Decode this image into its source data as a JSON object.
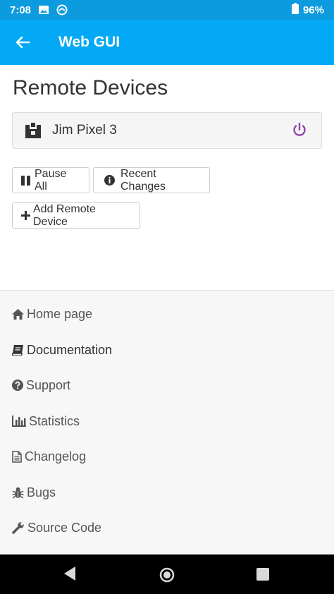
{
  "status_bar": {
    "time": "7:08",
    "battery": "96%",
    "icons": [
      "image-icon",
      "sync-icon",
      "battery-icon"
    ]
  },
  "app_bar": {
    "title": "Web GUI",
    "back_icon": "arrow-left-icon",
    "color": "#03a9f4"
  },
  "page": {
    "title": "Remote Devices",
    "devices": [
      {
        "name": "Jim Pixel 3",
        "icon": "device-identicon",
        "action_icon": "power-icon",
        "action_color": "#8e44ad"
      }
    ],
    "buttons": {
      "pause_all": "Pause All",
      "recent_changes": "Recent Changes",
      "add_remote_device": "Add Remote Device"
    }
  },
  "footer": {
    "links": [
      {
        "label": "Home page",
        "icon": "home-icon"
      },
      {
        "label": "Documentation",
        "icon": "book-icon"
      },
      {
        "label": "Support",
        "icon": "question-circle-icon"
      },
      {
        "label": "Statistics",
        "icon": "bar-chart-icon"
      },
      {
        "label": "Changelog",
        "icon": "file-text-icon"
      },
      {
        "label": "Bugs",
        "icon": "bug-icon"
      },
      {
        "label": "Source Code",
        "icon": "wrench-icon"
      }
    ]
  },
  "nav_bar": {
    "buttons": [
      "back-triangle-icon",
      "home-circle-icon",
      "recents-square-icon"
    ]
  }
}
